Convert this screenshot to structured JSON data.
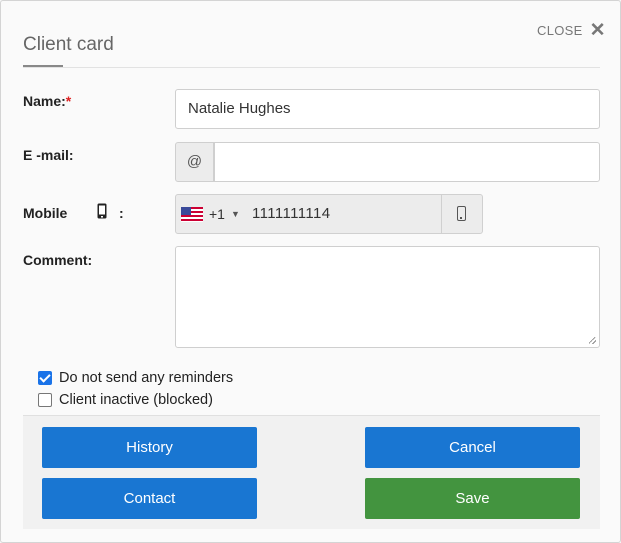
{
  "dialog": {
    "title": "Client card",
    "close_label": "CLOSE"
  },
  "form": {
    "name_label": "Name:",
    "required_mark": "*",
    "name_value": "Natalie Hughes",
    "email_label": "E -mail:",
    "email_addon": "@",
    "email_value": "",
    "mobile_label": "Mobile",
    "mobile_colon": ":",
    "country_dial_code": "+1",
    "country_flag": "us-flag-icon",
    "mobile_value": "1111111114",
    "comment_label": "Comment:",
    "comment_value": ""
  },
  "options": {
    "no_reminders_label": "Do not send any reminders",
    "no_reminders_checked": true,
    "inactive_label": "Client inactive (blocked)",
    "inactive_checked": false
  },
  "buttons": {
    "history": "History",
    "cancel": "Cancel",
    "contact": "Contact",
    "save": "Save"
  },
  "colors": {
    "primary": "#1976d2",
    "success": "#43943f",
    "required": "#dd2222",
    "checkbox": "#1a73e8"
  }
}
